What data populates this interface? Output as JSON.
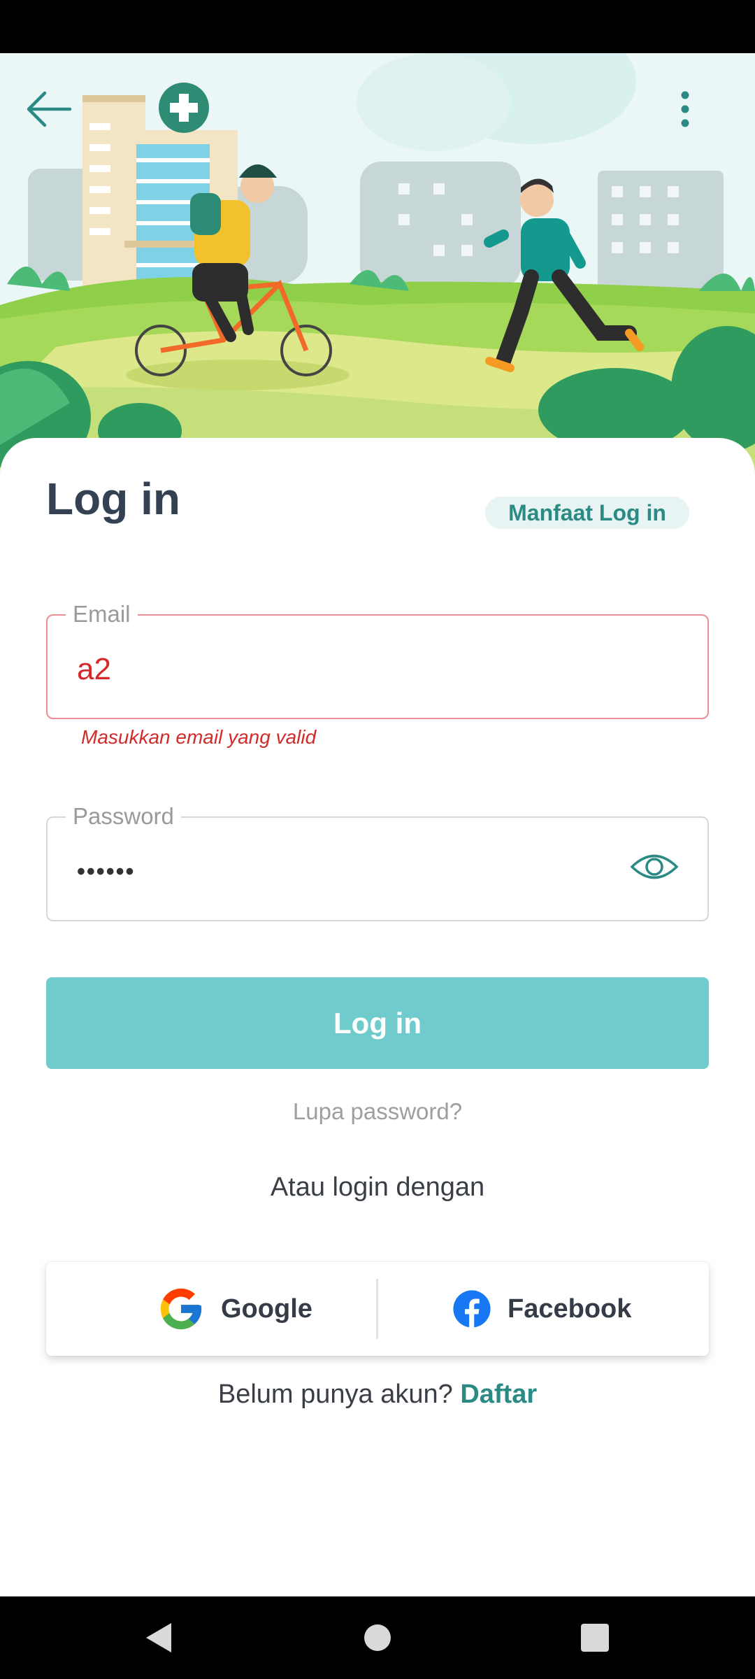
{
  "header": {
    "benefits_label": "Manfaat Log in"
  },
  "login": {
    "title": "Log in",
    "email": {
      "label": "Email",
      "value": "a2",
      "error": "Masukkan email yang valid"
    },
    "password": {
      "label": "Password",
      "value": "••••••"
    },
    "submit_label": "Log in",
    "forgot_label": "Lupa password?",
    "alt_login_label": "Atau login dengan"
  },
  "social": {
    "google_label": "Google",
    "facebook_label": "Facebook"
  },
  "signup": {
    "prompt": "Belum punya akun?",
    "link_label": "Daftar"
  },
  "colors": {
    "accent": "#2b8b84",
    "button": "#70cbcd",
    "error": "#d32a2a",
    "text_dark": "#344152"
  },
  "icons": {
    "back": "back-arrow-icon",
    "menu": "more-vertical-icon",
    "visibility": "eye-icon",
    "google": "google-logo-icon",
    "facebook": "facebook-logo-icon"
  }
}
